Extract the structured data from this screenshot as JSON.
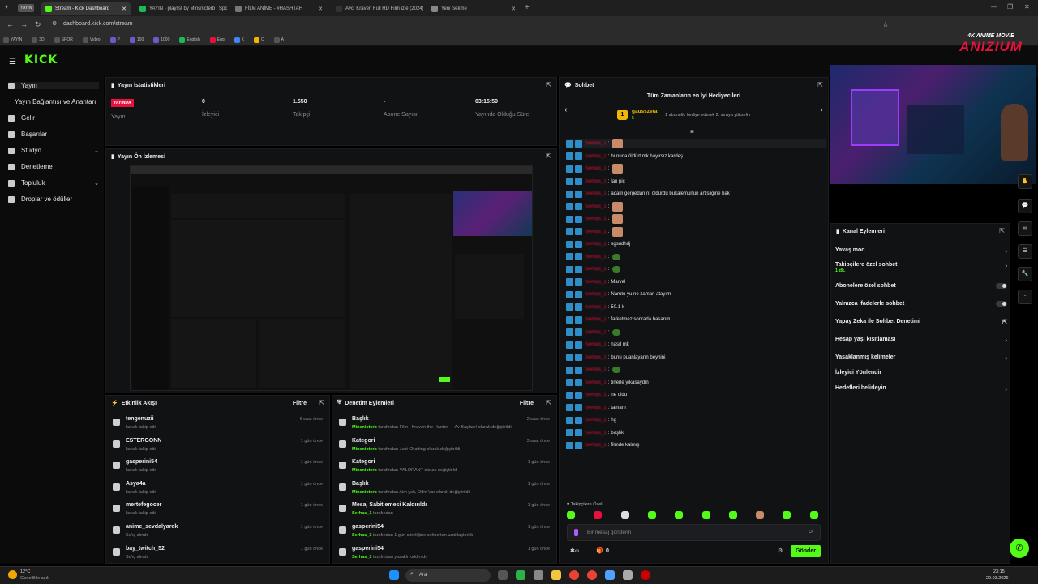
{
  "browser": {
    "pill": "YAYIN",
    "tabs": [
      {
        "label": "Stream - Kick Dashboard",
        "color": "#53fc18",
        "active": true
      },
      {
        "label": "YAYIN - playlist by Minsnicterb | Spotify",
        "color": "#1db954"
      },
      {
        "label": "FİLM ANİME - #HASHTAH",
        "color": "#777777"
      },
      {
        "label": "Avcı Kraven Full HD Film izle (2024)",
        "color": "#333333"
      },
      {
        "label": "Yeni Sekme",
        "color": "#888888"
      }
    ],
    "url": "dashboard.kick.com/stream",
    "bookmarks": [
      "YAYIN",
      "3D",
      "SPOR",
      "Video",
      "P",
      "100",
      "1000",
      "English",
      "Eng",
      "K",
      "C",
      "A"
    ]
  },
  "logo": "KICK",
  "overlay_brand": {
    "top": "4K ANIME MOVIE",
    "main": "ANIZIUM"
  },
  "sidebar": {
    "items": [
      {
        "label": "Yayın",
        "chevron": false
      },
      {
        "label": "Yayın Bağlantısı ve Anahtarı",
        "chevron": false
      },
      {
        "label": "Gelir",
        "chevron": false
      },
      {
        "label": "Başarılar",
        "chevron": false
      },
      {
        "label": "Stüdyo",
        "chevron": true
      },
      {
        "label": "Denetleme",
        "chevron": false
      },
      {
        "label": "Topluluk",
        "chevron": true
      },
      {
        "label": "Droplar ve ödüller",
        "chevron": false
      }
    ]
  },
  "stats": {
    "title": "Yayın İstatistikleri",
    "live_badge": "YAYINDA",
    "items": [
      {
        "value": "",
        "label": "Yayın"
      },
      {
        "value": "0",
        "label": "İzleyici"
      },
      {
        "value": "1.550",
        "label": "Takipçi"
      },
      {
        "value": "-",
        "label": "Abone Sayısı"
      },
      {
        "value": "03:15:59",
        "label": "Yayında Olduğu Süre"
      }
    ]
  },
  "preview": {
    "title": "Yayın Ön İzlemesi"
  },
  "activity": {
    "title": "Etkinlik Akışı",
    "filter": "Filtre",
    "rows": [
      {
        "name": "tengenuzii",
        "desc": "kanalı takip etti",
        "time": "6 saat önce"
      },
      {
        "name": "ESTERGONN",
        "desc": "kanalı takip etti",
        "time": "1 gün önce"
      },
      {
        "name": "gasperini54",
        "desc": "kanalı takip etti",
        "time": "1 gün önce"
      },
      {
        "name": "Asya4a",
        "desc": "kanalı takip etti",
        "time": "1 gün önce"
      },
      {
        "name": "mertefegocer",
        "desc": "kanalı takip etti",
        "time": "1 gün önce"
      },
      {
        "name": "anime_sevdalyarek",
        "desc": "Su'ıç alındı",
        "time": "1 gün önce"
      },
      {
        "name": "bay_twitch_52",
        "desc": "Su'ıç alındı",
        "time": "1 gün önce"
      }
    ]
  },
  "moderation": {
    "title": "Denetim Eylemleri",
    "filter": "Filtre",
    "rows": [
      {
        "name": "Başlık",
        "user": "Minsnicterb",
        "desc": " tarafından  Film | Kraven the Hunter — Av Başladı! olarak değiştirildi",
        "time": "2 saat önce"
      },
      {
        "name": "Kategori",
        "user": "Minsnicterb",
        "desc": " tarafından Just Chatting olarak değiştirildi",
        "time": "3 saat önce"
      },
      {
        "name": "Kategori",
        "user": "Minsnicterb",
        "desc": " tarafından VALORANT olarak değiştirildi",
        "time": "1 gün önce"
      },
      {
        "name": "Başlık",
        "user": "Minsnicterb",
        "desc": " tarafından  Aim yok, Odin Var olarak değiştirildi",
        "time": "1 gün önce"
      },
      {
        "name": "Mesaj Sabitlemesi Kaldırıldı",
        "user": "Serhas_1",
        "desc": " tarafından",
        "time": "1 gün önce"
      },
      {
        "name": "gasperini54",
        "user": "Serhas_1",
        "desc": " tarafından 1 gün süreliğine sohbetten uzaklaştırıldı",
        "time": "1 gün önce"
      },
      {
        "name": "gasperini54",
        "user": "Serhas_1",
        "desc": " tarafından yasaklı kaldırıldı",
        "time": "1 gün önce"
      }
    ]
  },
  "chat": {
    "title": "Sohbet",
    "top_gifters_title": "Tüm Zamanların en İyi Hediyecileri",
    "gifter_name": "gausszeta",
    "gifter_count": "5",
    "gifter_hint": "1 abonelik hediye ederek 2. sıraya yükselin",
    "messages": [
      {
        "user": "Serhas_1",
        "text": "",
        "emote": "face"
      },
      {
        "user": "Serhas_1",
        "text": "bunuda öldürt mk hayırsız kardeş",
        "emote": ""
      },
      {
        "user": "Serhas_1",
        "text": "",
        "emote": "face"
      },
      {
        "user": "Serhas_1",
        "text": "lan piç",
        "emote": ""
      },
      {
        "user": "Serhas_1",
        "text": "adam gergedan nı öldürdü bukalemunun artisligine bak",
        "emote": ""
      },
      {
        "user": "Serhas_1",
        "text": "",
        "emote": "face"
      },
      {
        "user": "Serhas_1",
        "text": "",
        "emote": "face"
      },
      {
        "user": "Serhas_1",
        "text": "",
        "emote": "face"
      },
      {
        "user": "Serhas_1",
        "text": "sgsudhdj",
        "emote": ""
      },
      {
        "user": "Serhas_1",
        "text": "",
        "emote": "pepe"
      },
      {
        "user": "Serhas_1",
        "text": "",
        "emote": "pepe"
      },
      {
        "user": "Serhas_1",
        "text": "Marvel",
        "emote": ""
      },
      {
        "user": "Serhas_1",
        "text": "Naruto yu ne zaman atayım",
        "emote": ""
      },
      {
        "user": "Serhas_1",
        "text": "50.1 k",
        "emote": ""
      },
      {
        "user": "Serhas_1",
        "text": "farketmez sonrada basarım",
        "emote": ""
      },
      {
        "user": "Serhas_1",
        "text": "",
        "emote": "pepe"
      },
      {
        "user": "Serhas_1",
        "text": "nasıl mk",
        "emote": ""
      },
      {
        "user": "Serhas_1",
        "text": "bunu puanlayarın beynini",
        "emote": ""
      },
      {
        "user": "Serhas_1",
        "text": "",
        "emote": "pepe"
      },
      {
        "user": "Serhas_1",
        "text": "tinerle yıkasaydin",
        "emote": ""
      },
      {
        "user": "Serhas_1",
        "text": "ne oldu",
        "emote": ""
      },
      {
        "user": "Serhas_1",
        "text": "tamam",
        "emote": ""
      },
      {
        "user": "Serhas_1",
        "text": "hg",
        "emote": ""
      },
      {
        "user": "Serhas_1",
        "text": "başlık",
        "emote": ""
      },
      {
        "user": "Serhas_1",
        "text": "filmde kalmış",
        "emote": ""
      }
    ],
    "followers_only": "Takipçilere Özel",
    "input_placeholder": "Bir mesaj gönderin",
    "points": "0",
    "send_label": "Gönder"
  },
  "channel_actions": {
    "title": "Kanal Eylemleri",
    "items": [
      {
        "label": "Yavaş mod",
        "kind": "chevron",
        "sub": ""
      },
      {
        "label": "Takipçilere özel sohbet",
        "kind": "chevron",
        "sub": "1 dk."
      },
      {
        "label": "Abonelere özel sohbet",
        "kind": "toggle",
        "sub": ""
      },
      {
        "label": "Yalnızca ifadelerle sohbet",
        "kind": "toggle",
        "sub": ""
      },
      {
        "label": "Yapay Zeka ile Sohbet Denetimi",
        "kind": "external",
        "sub": ""
      },
      {
        "label": "Hesap yaşı kısıtlaması",
        "kind": "chevron",
        "sub": ""
      },
      {
        "label": "Yasaklanmış kelimeler",
        "kind": "chevron",
        "sub": ""
      },
      {
        "label": "İzleyici Yönlendir",
        "kind": "none",
        "sub": ""
      },
      {
        "label": "Hedefleri belirleyin",
        "kind": "chevron",
        "sub": ""
      }
    ]
  },
  "taskbar": {
    "weather_temp": "12°C",
    "weather_desc": "Genellikle açık",
    "search": "Ara",
    "time": "23:15",
    "date": "20.03.2026"
  },
  "colors": {
    "accent": "#53fc18",
    "live": "#e9113c",
    "badge": "#2f8ec7"
  }
}
